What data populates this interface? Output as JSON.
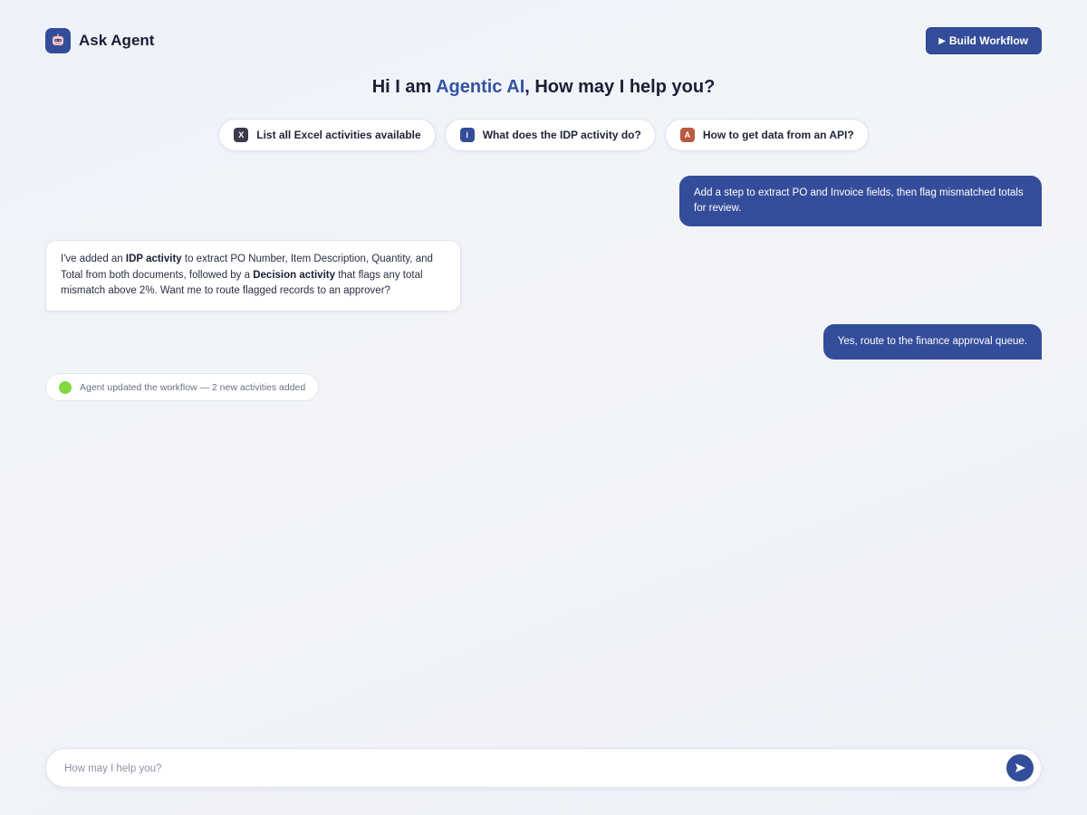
{
  "header": {
    "title": "Ask Agent",
    "logo_icon": "robot-icon",
    "build_button_label": "Build Workflow",
    "build_button_icon": "play-icon"
  },
  "greeting": {
    "prefix": "Hi I am ",
    "highlight": "Agentic AI",
    "suffix": ", How may I help you?"
  },
  "suggestions": [
    {
      "icon_letter": "X",
      "icon_name": "excel-icon",
      "icon_color": "#3a3a4a",
      "label": "List all Excel activities available"
    },
    {
      "icon_letter": "i",
      "icon_name": "info-icon",
      "icon_color": "#344d9a",
      "label": "What does the IDP activity do?"
    },
    {
      "icon_letter": "A",
      "icon_name": "api-icon",
      "icon_color": "#b95a3f",
      "label": "How to get data from an API?"
    }
  ],
  "chat": {
    "user_message_1": "Add a step to extract PO and Invoice fields, then flag mismatched totals for review.",
    "agent_message": {
      "t1": "I've added an ",
      "b1": "IDP activity",
      "t2": " to extract PO Number, Item Description, Quantity, and Total from both documents, followed by a ",
      "b2": "Decision activity",
      "t3": " that flags any total mismatch above 2%. Want me to route flagged records to an approver?"
    },
    "user_message_2": "Yes, route to the finance approval queue.",
    "status_text": "Agent updated the workflow — 2 new activities added"
  },
  "input": {
    "placeholder": "How may I help you?",
    "send_icon": "send-icon"
  },
  "colors": {
    "accent": "#344d9a",
    "status_dot": "#7fd93f"
  }
}
